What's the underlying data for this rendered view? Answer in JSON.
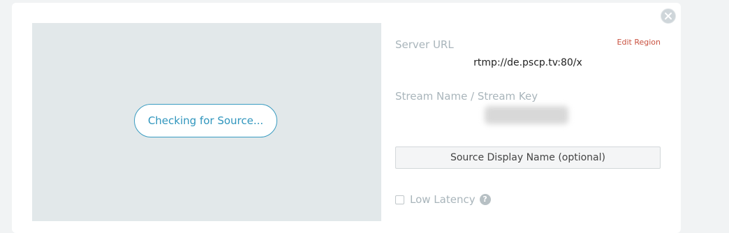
{
  "preview": {
    "checking_label": "Checking for Source..."
  },
  "server": {
    "label": "Server URL",
    "edit_region_link": "Edit Region",
    "url": "rtmp://de.pscp.tv:80/x"
  },
  "stream": {
    "label": "Stream Name / Stream Key"
  },
  "source_display_name": {
    "placeholder": "Source Display Name (optional)"
  },
  "low_latency": {
    "label": "Low Latency",
    "checked": false,
    "help_glyph": "?"
  },
  "icons": {
    "close": "close-icon",
    "help": "help-icon"
  },
  "colors": {
    "accent": "#2f95bd",
    "link": "#c9513f",
    "preview_bg": "#e2e8ea"
  }
}
